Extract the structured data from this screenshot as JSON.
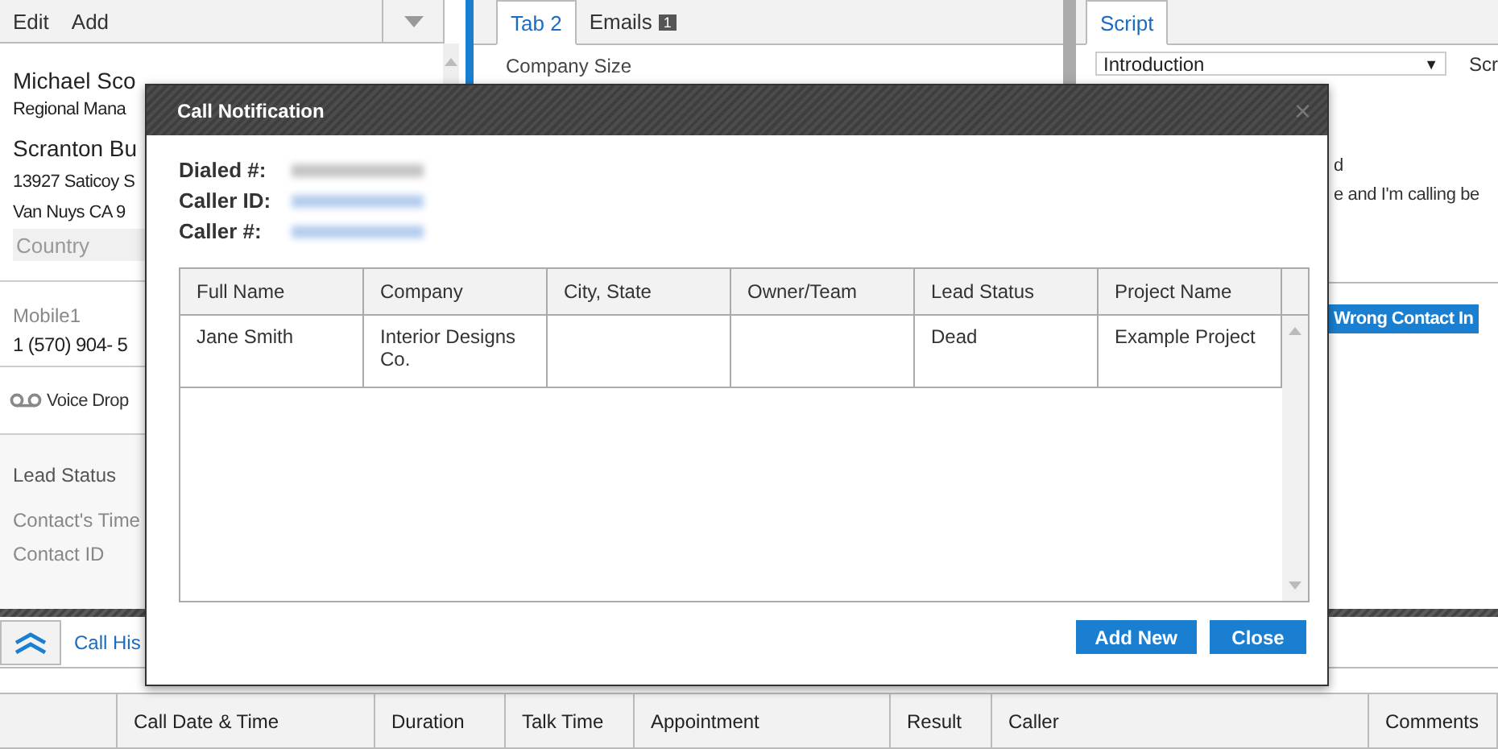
{
  "left_panel": {
    "menu": [
      {
        "label": "Edit"
      },
      {
        "label": "Add"
      }
    ],
    "contact": {
      "name": "Michael Sco",
      "title": "Regional Mana",
      "company": "Scranton Bu",
      "address_lines": [
        "13927 Saticoy S",
        "Van Nuys  CA  9"
      ],
      "country_placeholder": "Country"
    },
    "phone": {
      "label": "Mobile1",
      "value": "1 (570) 904- 5"
    },
    "voice_drop": "Voice Drop",
    "fields": [
      "Lead Status",
      "Contact's Time",
      "Contact ID"
    ]
  },
  "middle_panel": {
    "tabs": [
      {
        "label": "Tab 2",
        "selected": true
      },
      {
        "label": "Emails",
        "selected": false,
        "badge": "1"
      }
    ],
    "field_label": "Company Size"
  },
  "script_panel": {
    "tabs": [
      {
        "label": "Script",
        "selected": true
      }
    ],
    "dropdown": {
      "value": "Introduction",
      "arrow": "▼"
    },
    "side_label": "Scr",
    "lines": [
      "d",
      "e and I'm calling be"
    ],
    "button": "Wrong Contact In"
  },
  "modal": {
    "title": "Call Notification",
    "close": "×",
    "details": [
      {
        "label": "Dialed #:",
        "color": "#c4c4c4"
      },
      {
        "label": "Caller ID:",
        "color": "#b4cdee"
      },
      {
        "label": "Caller #:",
        "color": "#b4cdee"
      }
    ],
    "table": {
      "columns": [
        "Full Name",
        "Company",
        "City, State",
        "Owner/Team",
        "Lead Status",
        "Project Name"
      ],
      "rows": [
        [
          "Jane Smith",
          "Interior Designs Co.",
          "",
          "",
          "Dead",
          "Example Project"
        ]
      ]
    },
    "buttons": [
      "Add New",
      "Close"
    ]
  },
  "bottom_panel": {
    "tabs": [
      {
        "label": "Call His",
        "selected": true
      }
    ],
    "table": {
      "columns": [
        "Call Date & Time",
        "Duration",
        "Talk Time",
        "Appointment",
        "Result",
        "Caller",
        "Comments"
      ]
    }
  }
}
